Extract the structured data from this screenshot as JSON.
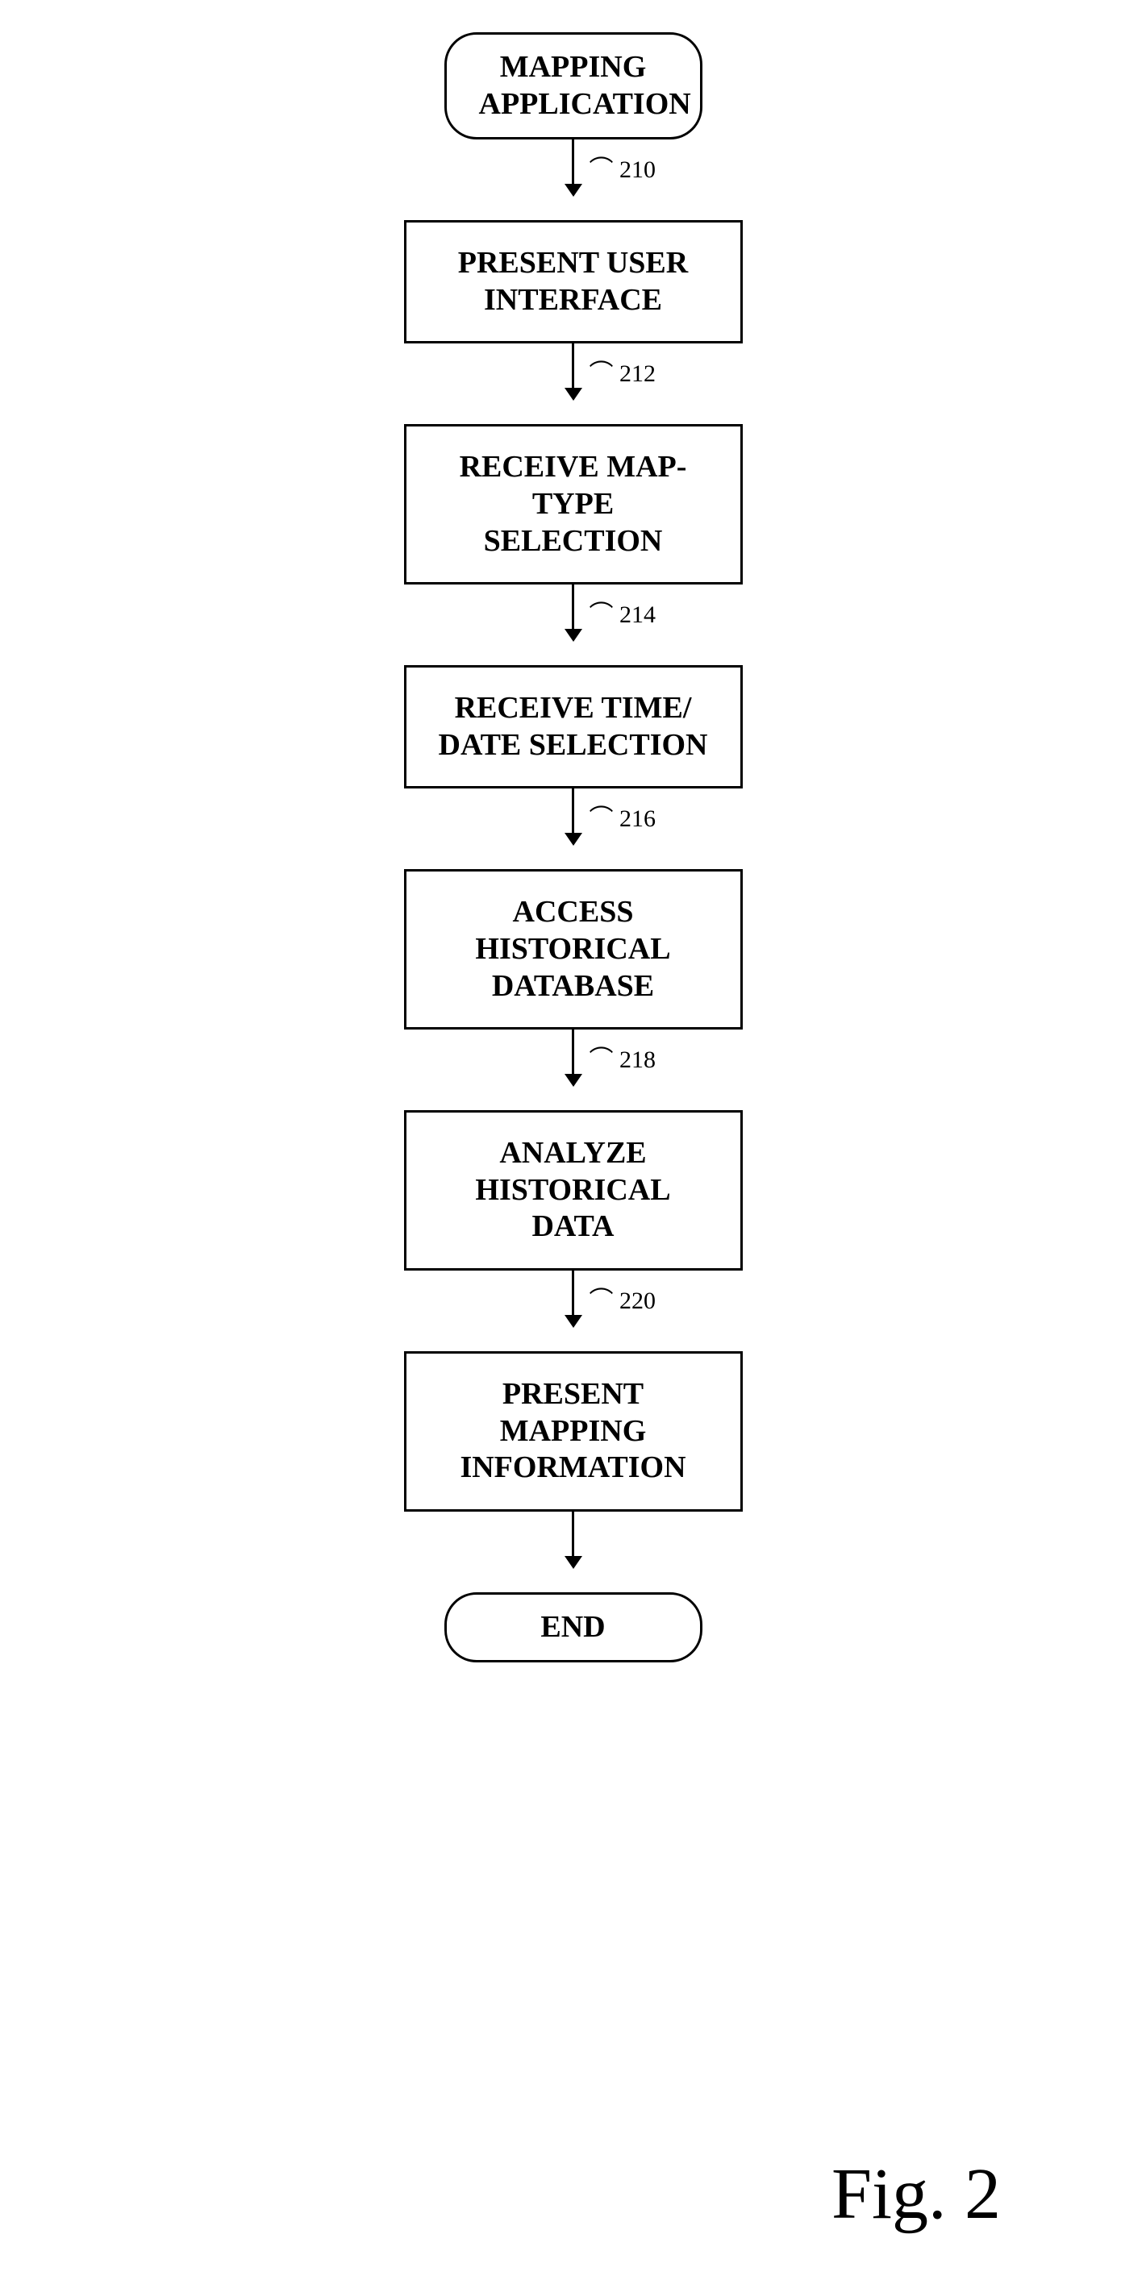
{
  "diagram": {
    "title": "Fig. 2",
    "start_label": "MAPPING\nAPPLICATION",
    "end_label": "END",
    "steps": [
      {
        "id": "step-210",
        "number": "210",
        "label": "PRESENT USER\nINTERFACE"
      },
      {
        "id": "step-212",
        "number": "212",
        "label": "RECEIVE MAP-TYPE\nSELECTION"
      },
      {
        "id": "step-214",
        "number": "214",
        "label": "RECEIVE TIME/\nDATE SELECTION"
      },
      {
        "id": "step-216",
        "number": "216",
        "label": "ACCESS\nHISTORICAL\nDATABASE"
      },
      {
        "id": "step-218",
        "number": "218",
        "label": "ANALYZE\nHISTORICAL DATA"
      },
      {
        "id": "step-220",
        "number": "220",
        "label": "PRESENT MAPPING\nINFORMATION"
      }
    ]
  }
}
